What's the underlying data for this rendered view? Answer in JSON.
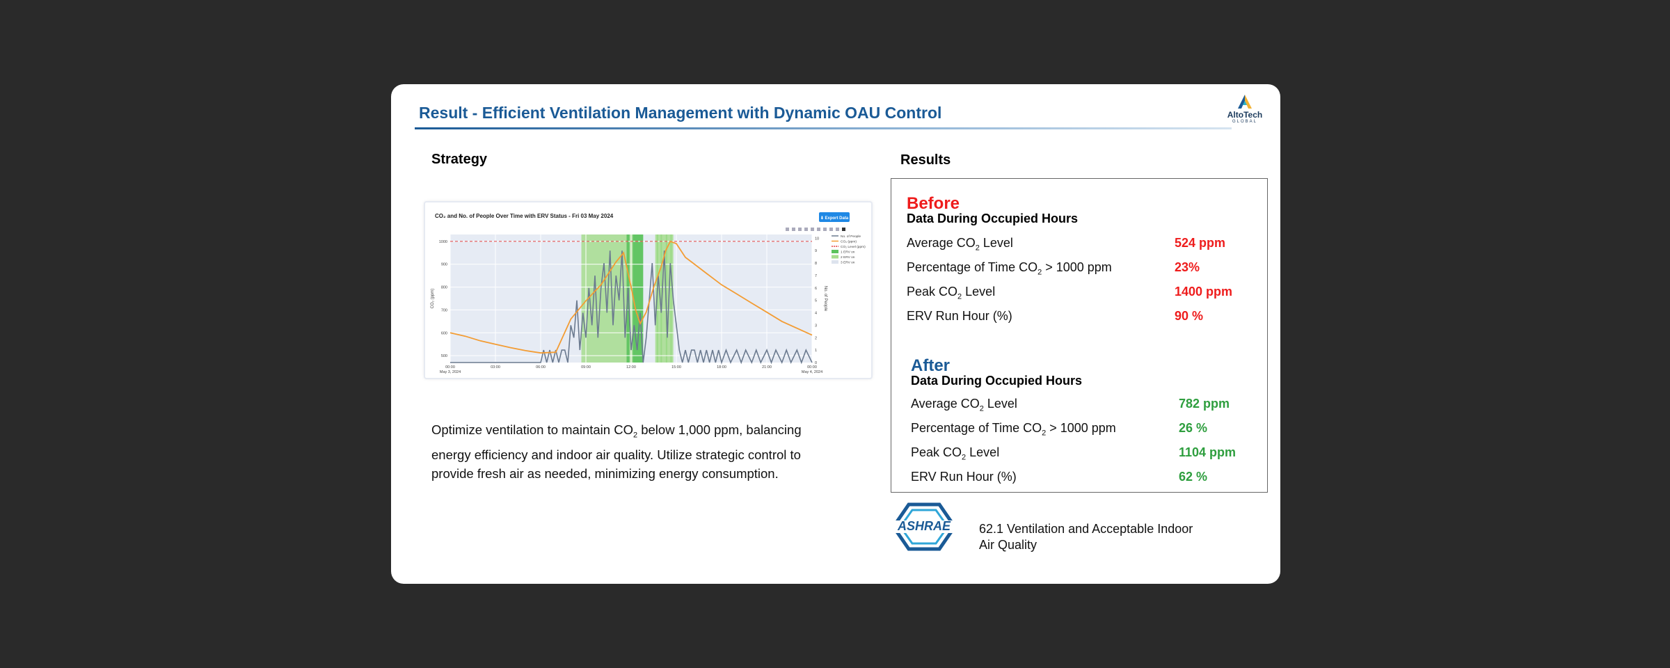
{
  "slide": {
    "title": "Result - Efficient Ventilation Management with Dynamic OAU Control",
    "logo": {
      "name": "AltoTech",
      "sub": "GLOBAL"
    }
  },
  "strategy": {
    "heading": "Strategy",
    "description_prefix": "Optimize ventilation to maintain CO",
    "description_sub": "2",
    "description_suffix": " below 1,000 ppm, balancing energy efficiency and indoor air quality. Utilize strategic control to provide fresh air as needed, minimizing energy consumption."
  },
  "chart": {
    "title": "CO₂ and No. of People Over Time with ERV Status - Fri 03 May 2024",
    "export_label": "⬇ Export Data",
    "y_left_label": "CO₂ (ppm)",
    "y_right_label": "No. of People",
    "legend": [
      "No. of People",
      "CO₂ (ppm)",
      "CO₂ Level (ppm)",
      "1 ERV on",
      "2 ERV on",
      "3 ERV on"
    ],
    "colors": {
      "people": "#6b7a8f",
      "co2": "#f39c33",
      "threshold": "#e34040",
      "erv1": "#5cc35c",
      "erv2": "#a6dd8e",
      "plot_bg": "#e6ebf4"
    }
  },
  "chart_data": {
    "type": "line",
    "title": "CO₂ and No. of People Over Time with ERV Status - Fri 03 May 2024",
    "xlabel": "",
    "ylabel": "CO₂ (ppm)",
    "y2label": "No. of People",
    "x_ticks": [
      "00:00\nMay 3, 2024",
      "03:00",
      "06:00",
      "09:00",
      "12:00",
      "15:00",
      "18:00",
      "21:00",
      "00:00\nMay 4, 2024"
    ],
    "y_ticks": [
      500,
      600,
      700,
      800,
      900,
      1000
    ],
    "y2_ticks": [
      0,
      1,
      2,
      3,
      4,
      5,
      6,
      7,
      8,
      9,
      10
    ],
    "ylim": [
      470,
      1030
    ],
    "y2lim": [
      0,
      10.3
    ],
    "threshold": 1000,
    "co2_series": {
      "name": "CO₂ (ppm)",
      "x_hours": [
        0,
        1,
        2,
        3,
        4,
        5,
        6,
        7,
        8,
        9,
        10,
        10.5,
        11,
        11.5,
        12,
        12.3,
        12.6,
        13,
        13.5,
        14,
        14.3,
        14.6,
        15,
        15.3,
        15.6,
        16,
        16.5,
        17,
        18,
        19,
        20,
        21,
        22,
        23,
        24
      ],
      "values": [
        600,
        585,
        565,
        550,
        535,
        522,
        512,
        515,
        660,
        740,
        810,
        860,
        910,
        950,
        800,
        700,
        640,
        690,
        800,
        890,
        960,
        1000,
        990,
        960,
        930,
        910,
        885,
        860,
        810,
        770,
        730,
        690,
        650,
        620,
        590
      ]
    },
    "people_series": {
      "name": "No. of People",
      "x_hours": [
        0,
        6,
        6.2,
        6.4,
        6.6,
        6.8,
        7,
        7.2,
        7.4,
        7.6,
        7.8,
        8,
        8.2,
        8.4,
        8.6,
        8.8,
        9,
        9.2,
        9.4,
        9.6,
        9.8,
        10,
        10.2,
        10.4,
        10.6,
        10.8,
        11,
        11.2,
        11.4,
        11.6,
        11.8,
        12,
        12.2,
        12.4,
        12.6,
        12.8,
        13,
        13.2,
        13.4,
        13.6,
        13.8,
        14,
        14.2,
        14.4,
        14.6,
        14.8,
        15,
        15.2,
        15.4,
        15.6,
        15.8,
        16,
        16.2,
        16.4,
        16.6,
        16.8,
        17,
        17.2,
        17.4,
        17.6,
        17.8,
        18,
        18.3,
        18.6,
        19,
        19.3,
        19.6,
        20,
        20.3,
        20.6,
        21,
        21.3,
        21.6,
        22,
        22.3,
        22.6,
        23,
        23.3,
        23.6,
        24
      ],
      "values": [
        0,
        0,
        1,
        0,
        1,
        0,
        1,
        0,
        1,
        1,
        0,
        3,
        2,
        5,
        1,
        4,
        2,
        6,
        3,
        7,
        2,
        6,
        8,
        4,
        9,
        3,
        7,
        5,
        9,
        2,
        6,
        1,
        3,
        1,
        4,
        0,
        2,
        5,
        8,
        3,
        7,
        4,
        9,
        2,
        8,
        5,
        3,
        1,
        0,
        1,
        0,
        1,
        1,
        0,
        1,
        0,
        1,
        0,
        1,
        0,
        1,
        0,
        1,
        0,
        1,
        0,
        1,
        0,
        1,
        0,
        1,
        0,
        1,
        0,
        1,
        0,
        1,
        0,
        1,
        0
      ]
    },
    "erv_periods": [
      {
        "name": "1 ERV on",
        "start": 11.7,
        "end": 11.9
      },
      {
        "name": "1 ERV on",
        "start": 12.1,
        "end": 12.8
      },
      {
        "name": "1 ERV on",
        "start": 13.7,
        "end": 13.8
      },
      {
        "name": "1 ERV on",
        "start": 13.95,
        "end": 14.05
      },
      {
        "name": "1 ERV on",
        "start": 14.3,
        "end": 14.4
      },
      {
        "name": "1 ERV on",
        "start": 14.6,
        "end": 14.7
      },
      {
        "name": "2 ERV on",
        "start": 8.7,
        "end": 11.7
      },
      {
        "name": "2 ERV on",
        "start": 11.9,
        "end": 12.1
      },
      {
        "name": "2 ERV on",
        "start": 13.6,
        "end": 14.8
      }
    ],
    "grid": true,
    "legend_position": "right"
  },
  "results": {
    "heading": "Results",
    "before": {
      "label": "Before",
      "subtitle": "Data During Occupied Hours",
      "rows": [
        {
          "label_pre": "Average CO",
          "label_sub": "2",
          "label_post": " Level",
          "value": "524 ppm"
        },
        {
          "label_pre": "Percentage of Time CO",
          "label_sub": "2",
          "label_post": " > 1000 ppm",
          "value": "23%"
        },
        {
          "label_pre": "Peak CO",
          "label_sub": "2",
          "label_post": " Level",
          "value": "1400 ppm"
        },
        {
          "label_pre": "ERV Run Hour (%)",
          "label_sub": "",
          "label_post": "",
          "value": "90 %"
        }
      ]
    },
    "after": {
      "label": "After",
      "subtitle": "Data During Occupied Hours",
      "rows": [
        {
          "label_pre": "Average CO",
          "label_sub": "2",
          "label_post": " Level",
          "value": "782 ppm"
        },
        {
          "label_pre": "Percentage of Time CO",
          "label_sub": "2",
          "label_post": " > 1000 ppm",
          "value": "26 %"
        },
        {
          "label_pre": "Peak CO",
          "label_sub": "2",
          "label_post": " Level",
          "value": "1104 ppm"
        },
        {
          "label_pre": "ERV Run Hour (%)",
          "label_sub": "",
          "label_post": "",
          "value": "62 %"
        }
      ]
    }
  },
  "reference": {
    "logo_text": "ASHRAE",
    "text": "62.1 Ventilation and Acceptable Indoor Air Quality"
  }
}
